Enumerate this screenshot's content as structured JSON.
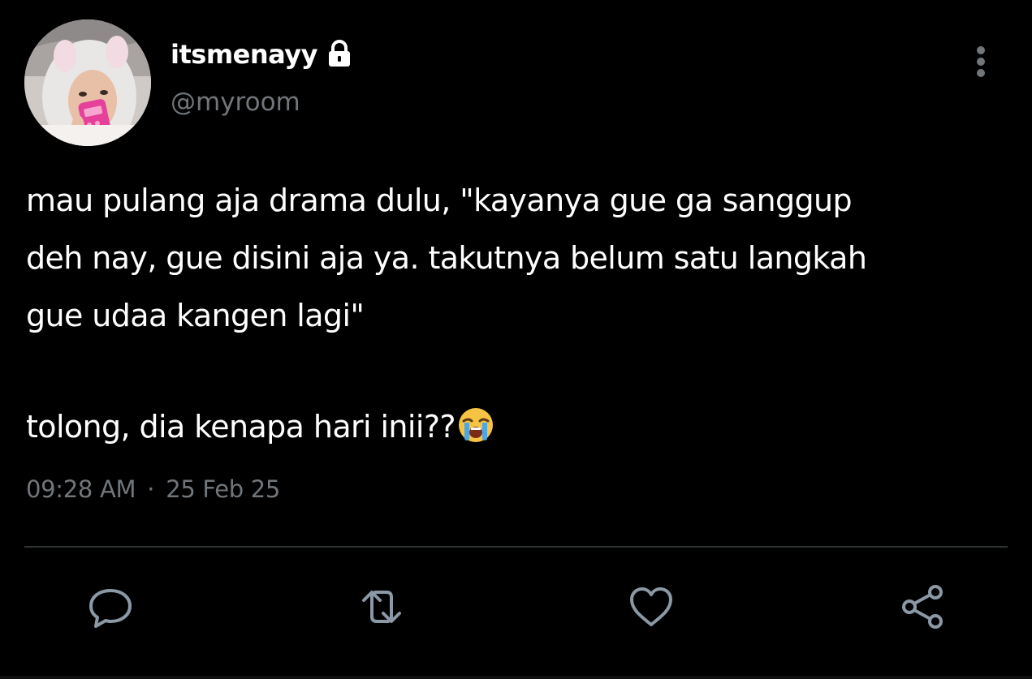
{
  "user": {
    "display_name": "itsmenayy",
    "handle": "@myroom",
    "protected": true,
    "avatar_icon": "avatar-photo"
  },
  "tweet": {
    "lines": [
      "mau pulang aja drama dulu, \"kayanya gue ga sanggup",
      "deh nay, gue disini aja ya. takutnya belum satu langkah",
      "gue udaa kangen lagi\""
    ],
    "second_paragraph": "tolong, dia kenapa hari inii??",
    "emoji": "loudly-crying-face",
    "time": "09:28 AM",
    "separator": "·",
    "date": "25 Feb 25"
  },
  "actions": [
    {
      "name": "reply",
      "icon": "comment-icon"
    },
    {
      "name": "retweet",
      "icon": "retweet-icon"
    },
    {
      "name": "like",
      "icon": "heart-icon"
    },
    {
      "name": "share",
      "icon": "share-icon"
    }
  ],
  "colors": {
    "background": "#000000",
    "text_primary": "#ffffff",
    "text_secondary": "#71767b",
    "divider": "#2f3336",
    "icon": "#8b98a5"
  }
}
